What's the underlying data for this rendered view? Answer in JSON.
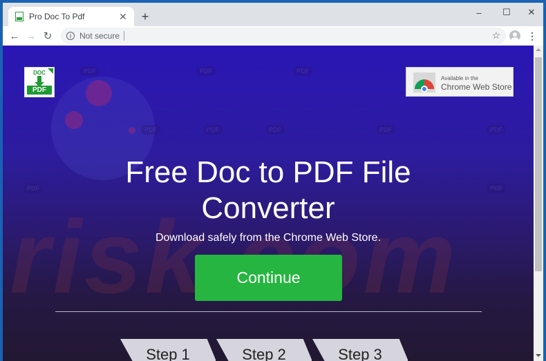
{
  "browser": {
    "tab_title": "Pro Doc To Pdf",
    "tab_close_icon": "close-icon",
    "new_tab_icon": "plus-icon",
    "window_controls": {
      "minimize": "–",
      "maximize": "☐",
      "close": "✕"
    },
    "nav": {
      "back": "←",
      "forward": "→",
      "reload": "↻"
    },
    "address_bar": {
      "security_label": "Not secure",
      "info_glyph": "i",
      "url": ""
    },
    "bookmark_icon": "☆",
    "menu_icon": "⋮"
  },
  "page": {
    "logo": {
      "top_label": "DOC",
      "bottom_label": "PDF"
    },
    "badge": {
      "small_text": "Available in the",
      "big_text": "Chrome Web Store"
    },
    "headline_line1": "Free Doc to PDF File",
    "headline_line2": "Converter",
    "subheadline": "Download safely from the Chrome Web Store.",
    "cta_label": "Continue",
    "steps": [
      {
        "label": "Step 1"
      },
      {
        "label": "Step 2"
      },
      {
        "label": "Step 3"
      }
    ],
    "watermark_text": "risk.com",
    "colors": {
      "cta": "#26b540",
      "background_top": "#2a16b5",
      "background_bottom": "#231832",
      "logo_green": "#1e9a35"
    }
  }
}
